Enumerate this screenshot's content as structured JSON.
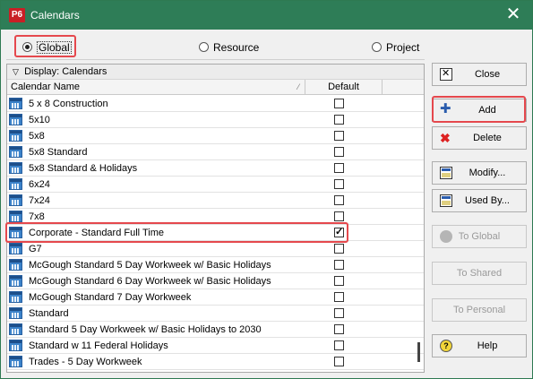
{
  "window": {
    "app_icon_text": "P6",
    "title": "Calendars",
    "close_glyph": "✕"
  },
  "scope": {
    "options": [
      {
        "label": "Global",
        "selected": true
      },
      {
        "label": "Resource",
        "selected": false
      },
      {
        "label": "Project",
        "selected": false
      }
    ]
  },
  "grid": {
    "display_label": "Display: Calendars",
    "columns": {
      "name": "Calendar Name",
      "default": "Default"
    },
    "rows": [
      {
        "name": "5 x 8 Construction",
        "default": false
      },
      {
        "name": "5x10",
        "default": false
      },
      {
        "name": "5x8",
        "default": false
      },
      {
        "name": "5x8 Standard",
        "default": false
      },
      {
        "name": "5x8 Standard & Holidays",
        "default": false
      },
      {
        "name": "6x24",
        "default": false
      },
      {
        "name": "7x24",
        "default": false
      },
      {
        "name": "7x8",
        "default": false
      },
      {
        "name": "Corporate - Standard Full Time",
        "default": true
      },
      {
        "name": "G7",
        "default": false
      },
      {
        "name": "McGough Standard 5 Day Workweek w/ Basic Holidays",
        "default": false
      },
      {
        "name": "McGough Standard 6 Day Workweek w/ Basic Holidays",
        "default": false
      },
      {
        "name": "McGough Standard 7 Day Workweek",
        "default": false
      },
      {
        "name": "Standard",
        "default": false
      },
      {
        "name": "Standard 5 Day Workweek w/ Basic Holidays to 2030",
        "default": false
      },
      {
        "name": "Standard w 11 Federal Holidays",
        "default": false
      },
      {
        "name": "Trades -  5 Day Workweek",
        "default": false
      }
    ]
  },
  "buttons": {
    "close": "Close",
    "add": "Add",
    "delete": "Delete",
    "modify": "Modify...",
    "used_by": "Used By...",
    "to_global": "To Global",
    "to_shared": "To Shared",
    "to_personal": "To Personal",
    "help": "Help"
  },
  "colors": {
    "titlebar": "#2e7d57",
    "highlight_box": "#e5484d",
    "app_icon": "#c91f25"
  }
}
